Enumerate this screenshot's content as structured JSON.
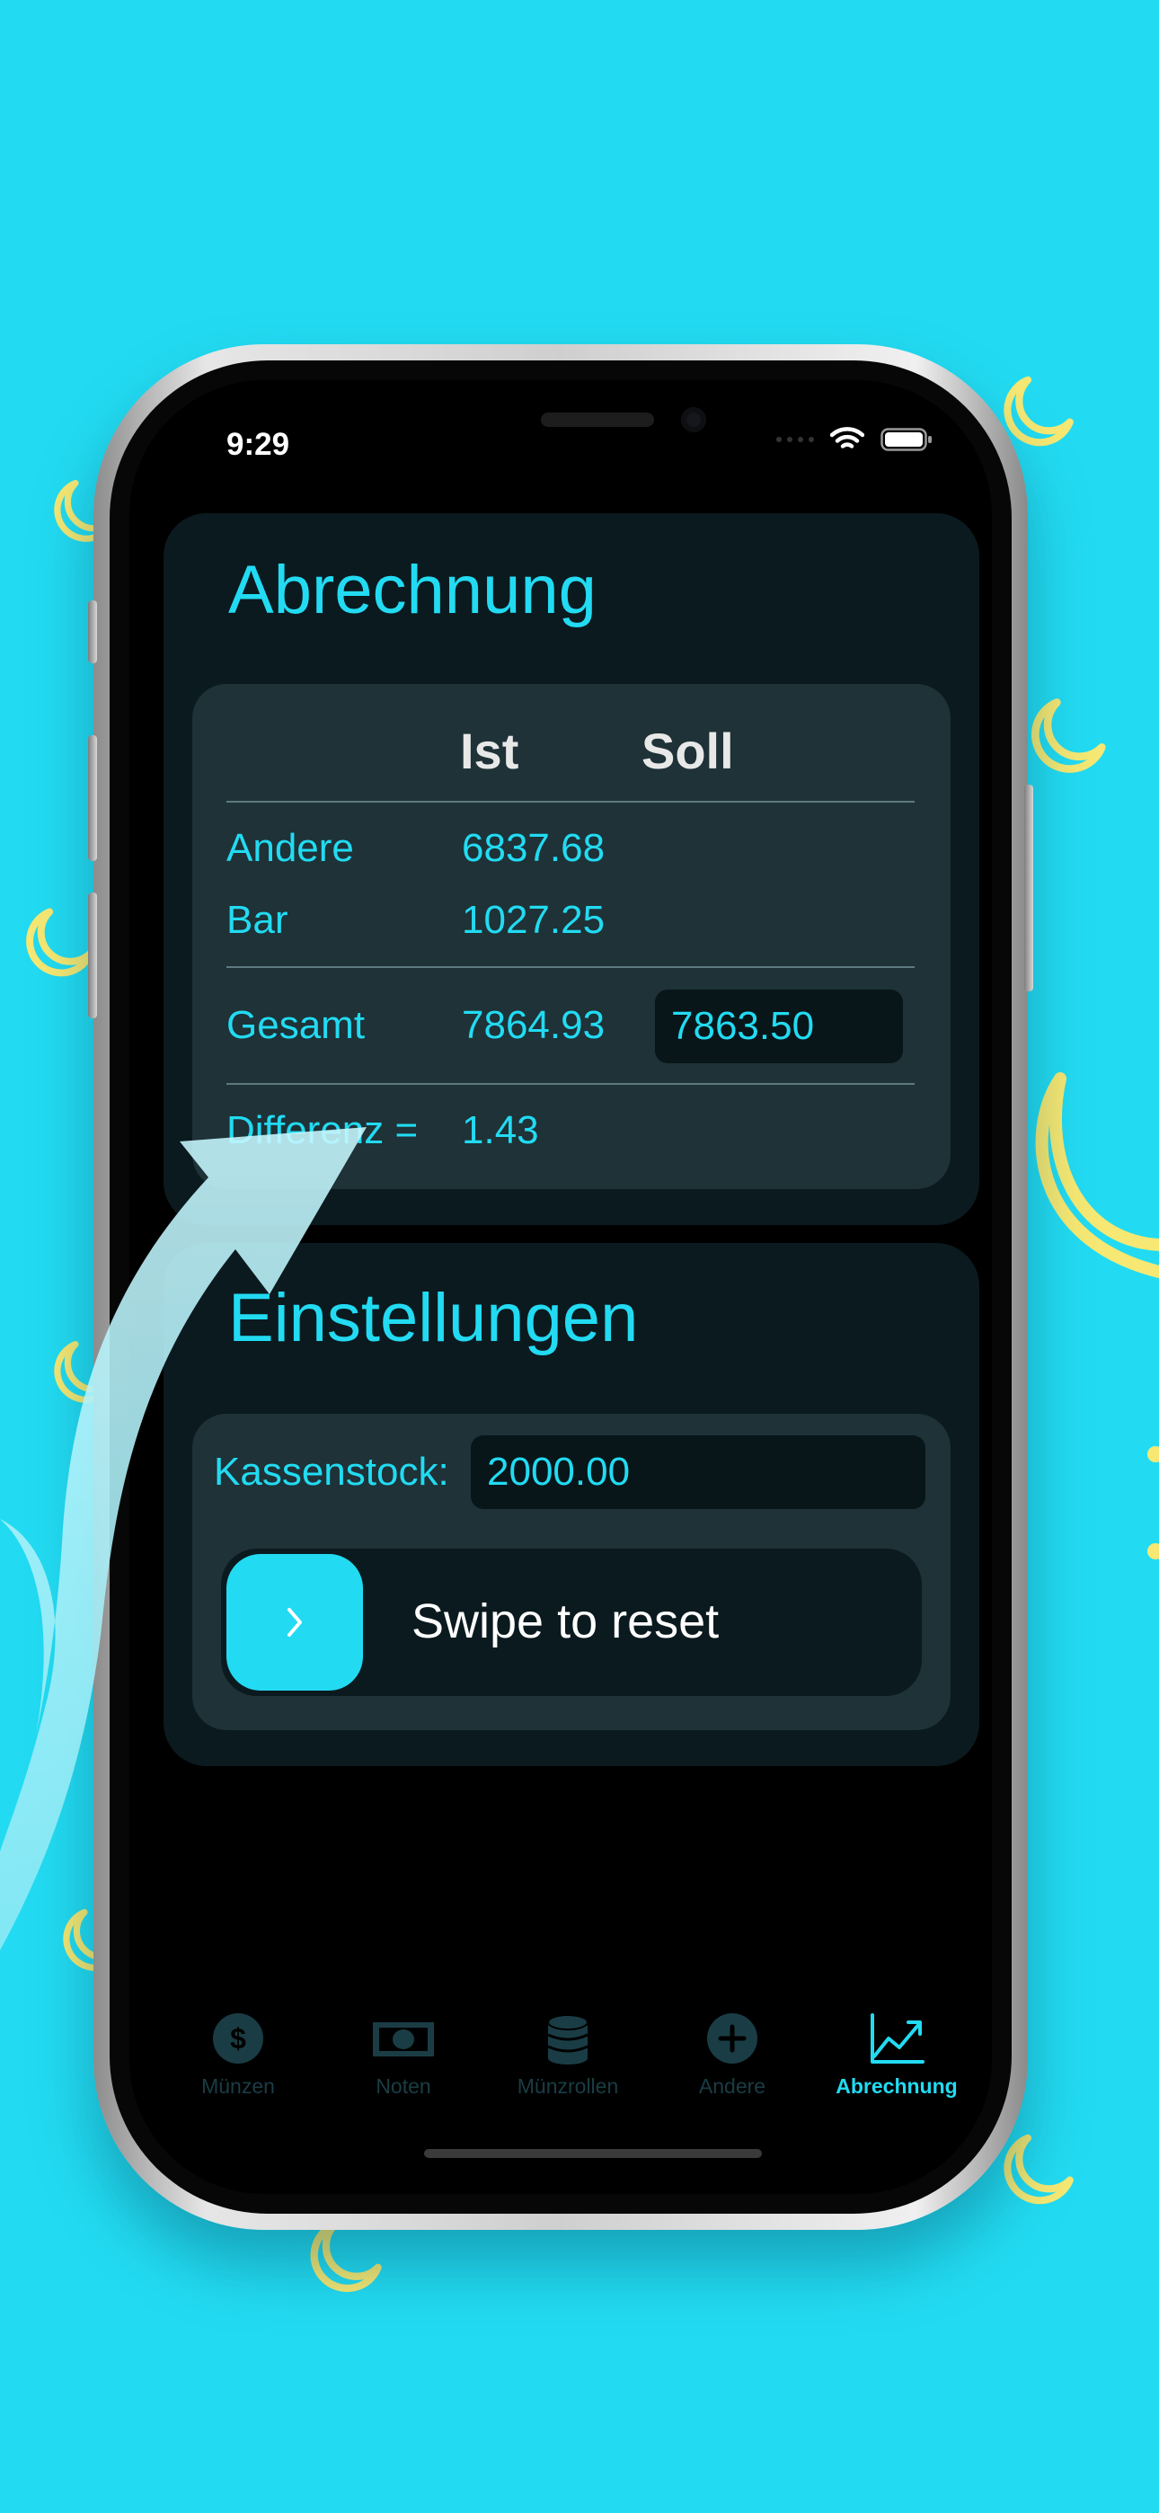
{
  "status_bar": {
    "time": "9:29"
  },
  "abrechnung": {
    "title": "Abrechnung",
    "headers": {
      "ist": "Ist",
      "soll": "Soll"
    },
    "rows": [
      {
        "label": "Andere",
        "ist": "6837.68"
      },
      {
        "label": "Bar",
        "ist": "1027.25"
      }
    ],
    "gesamt": {
      "label": "Gesamt",
      "ist": "7864.93",
      "soll": "7863.50"
    },
    "differenz": {
      "label": "Differenz =",
      "value": "1.43"
    }
  },
  "einstellungen": {
    "title": "Einstellungen",
    "kassenstock_label": "Kassenstock:",
    "kassenstock_value": "2000.00",
    "swipe_label": "Swipe to reset",
    "swipe_icon": "chevron-right-icon"
  },
  "tabs": [
    {
      "label": "Münzen",
      "icon": "dollar-coin-icon",
      "active": false
    },
    {
      "label": "Noten",
      "icon": "banknote-icon",
      "active": false
    },
    {
      "label": "Münzrollen",
      "icon": "coin-stack-icon",
      "active": false
    },
    {
      "label": "Andere",
      "icon": "plus-circle-icon",
      "active": false
    },
    {
      "label": "Abrechnung",
      "icon": "chart-line-icon",
      "active": true
    }
  ],
  "colors": {
    "background": "#22dbf2",
    "accent": "#22dbf2",
    "moon": "#f6e873",
    "card": "#0b1a1f",
    "inner_card": "#1e3237",
    "tab_inactive": "#1a3d45"
  }
}
